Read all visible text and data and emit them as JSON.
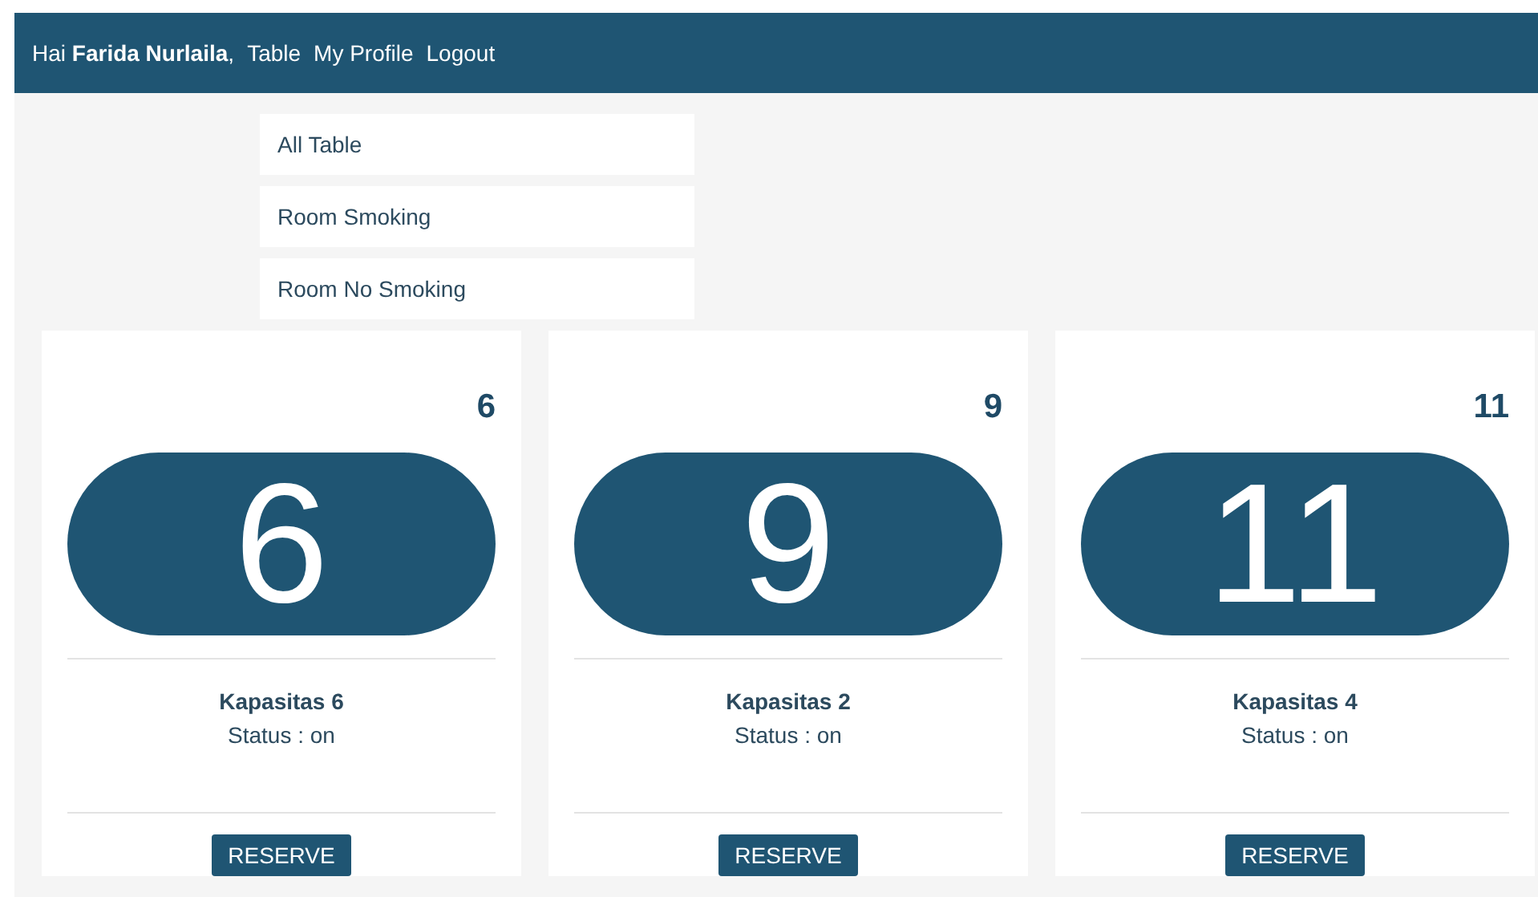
{
  "header": {
    "greeting": "Hai **Farida Nurlaila**,",
    "links": [
      "Table",
      "My Profile",
      "Logout"
    ]
  },
  "filters": [
    {
      "label": "All Table"
    },
    {
      "label": "Room Smoking"
    },
    {
      "label": "Room No Smoking"
    }
  ],
  "tables": [
    {
      "number": "6",
      "badge": "6",
      "capacity": "Kapasitas 6",
      "status": "Status : on",
      "action": "RESERVE"
    },
    {
      "number": "9",
      "badge": "9",
      "capacity": "Kapasitas 2",
      "status": "Status : on",
      "action": "RESERVE"
    },
    {
      "number": "11",
      "badge": "11",
      "capacity": "Kapasitas 4",
      "status": "Status : on",
      "action": "RESERVE"
    }
  ]
}
